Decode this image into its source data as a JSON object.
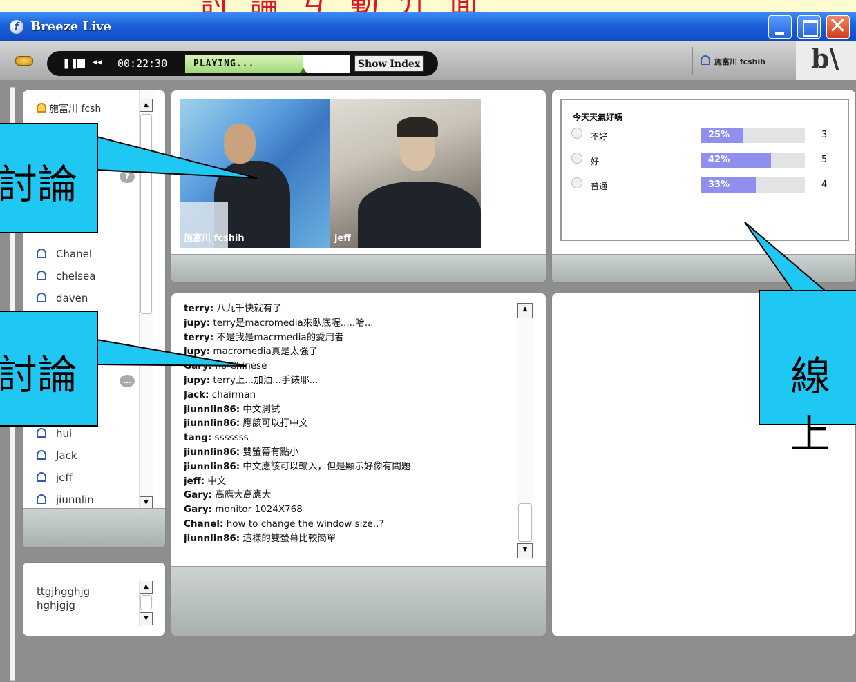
{
  "slide_header": "討論互動介面",
  "window": {
    "title": "Breeze Live"
  },
  "toolbar": {
    "time": "00:22:30",
    "status": "PLAYING...",
    "progress": 0.72,
    "show_index": "Show Index",
    "current_user": "施富川 fcsh­ih",
    "brand": "b\\"
  },
  "attendees": {
    "items": [
      {
        "name": "施富川 fcsh",
        "host": true
      },
      {
        "name": "Chanel"
      },
      {
        "name": "chelsea"
      },
      {
        "name": "daven"
      },
      {
        "name": "hui"
      },
      {
        "name": "Jack"
      },
      {
        "name": "jeff"
      },
      {
        "name": "jiunnlin"
      }
    ]
  },
  "note": {
    "text": "ttgjhgghjg\nhghjgjg"
  },
  "camera": {
    "feeds": [
      {
        "label": "施富川 fcshih"
      },
      {
        "label": "jeff"
      }
    ]
  },
  "poll": {
    "question": "今天天氣好嗎",
    "options": [
      {
        "label": "不好",
        "percent": 25,
        "percent_label": "25%",
        "count": "3"
      },
      {
        "label": "好",
        "percent": 42,
        "percent_label": "42%",
        "count": "5"
      },
      {
        "label": "普通",
        "percent": 33,
        "percent_label": "33%",
        "count": "4"
      }
    ]
  },
  "chat": {
    "messages": [
      {
        "user": "terry:",
        "text": " 八九千快就有了"
      },
      {
        "user": "jupy:",
        "text": " terry是macromedia來臥底喔.....哈..."
      },
      {
        "user": "terry:",
        "text": " 不是我是macrmedia的愛用者"
      },
      {
        "user": "jupy:",
        "text": " macromedia真是太強了"
      },
      {
        "user": "Gary:",
        "text": " no Chinese"
      },
      {
        "user": "jupy:",
        "text": " terry上...加油...手錶耶..."
      },
      {
        "user": "Jack:",
        "text": " chairman"
      },
      {
        "user": "jiunnlin86:",
        "text": " 中文測試"
      },
      {
        "user": "jiunnlin86:",
        "text": " 應該可以打中文"
      },
      {
        "user": "tang:",
        "text": " sssssss"
      },
      {
        "user": "jiunnlin86:",
        "text": " 雙螢幕有點小"
      },
      {
        "user": "jiunnlin86:",
        "text": " 中文應該可以輸入，但是顯示好像有問題"
      },
      {
        "user": "jeff:",
        "text": " 中文"
      },
      {
        "user": "Gary:",
        "text": " 高應大高應大"
      },
      {
        "user": "Gary:",
        "text": " monitor 1024X768"
      },
      {
        "user": "Chanel:",
        "text": " how to change the window size..?"
      },
      {
        "user": "jiunnlin86:",
        "text": " 這樣的雙螢幕比較簡單"
      }
    ]
  },
  "callouts": {
    "video_discussion": "討論",
    "text_discussion": "討論",
    "online_vote": "線上"
  },
  "colors": {
    "callout": "#1fc8f2",
    "poll_bar": "#8f8ff0",
    "title_bar": "#1b5fd8",
    "slide_text": "#e0141c"
  }
}
